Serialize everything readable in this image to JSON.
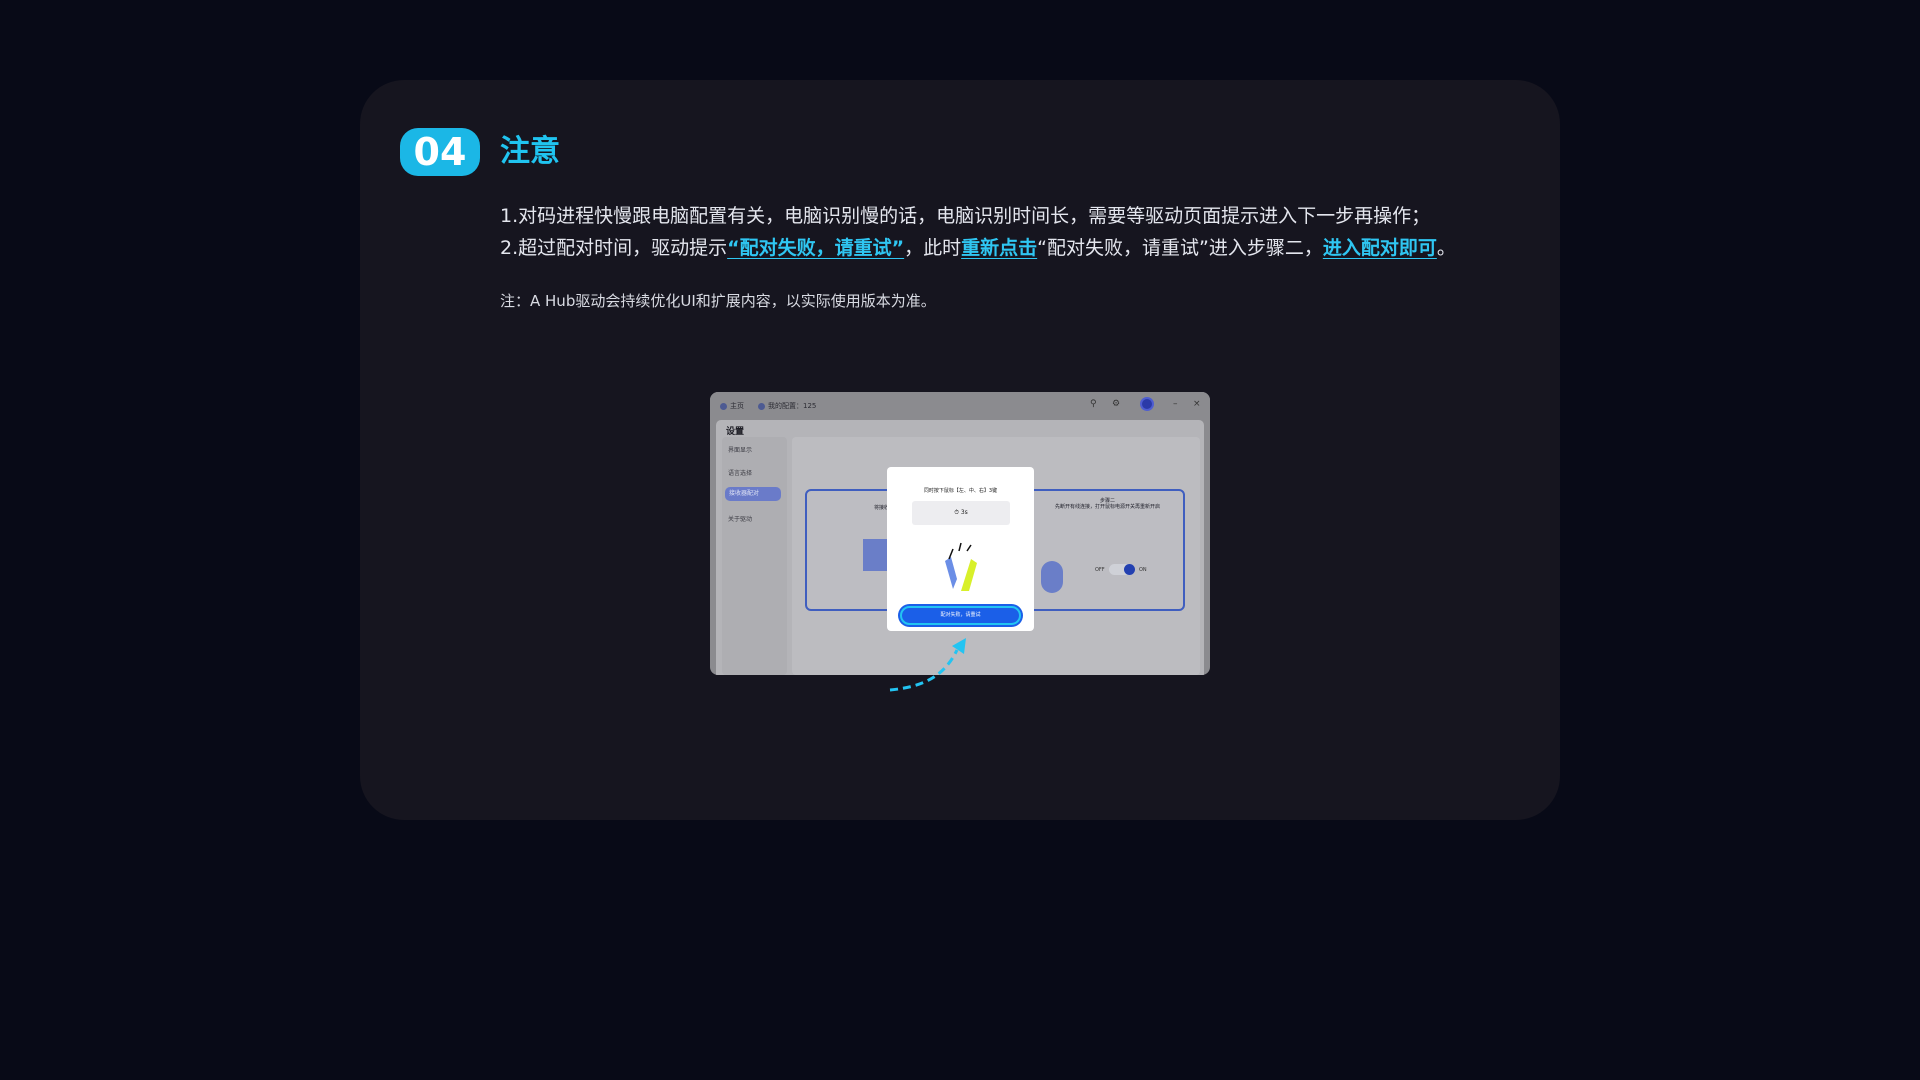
{
  "step": {
    "number": "04",
    "title": "注意"
  },
  "lines": {
    "l1": "1.对码进程快慢跟电脑配置有关，电脑识别慢的话，电脑识别时间长，需要等驱动页面提示进入下一步再操作；",
    "l2_a": "2.超过配对时间，驱动提示",
    "l2_link1": "“配对失败，请重试”",
    "l2_b": "，此时",
    "l2_link2": "重新点击",
    "l2_c": "“配对失败，请重试”进入步骤二，",
    "l2_link3": "进入配对即可",
    "l2_d": "。"
  },
  "note": "注：A Hub驱动会持续优化UI和扩展内容，以实际使用版本为准。",
  "screenshot": {
    "titlebar": {
      "home": "主页",
      "config": "我的配置：125"
    },
    "window_title": "设置",
    "sidebar": [
      "界面显示",
      "语言选择",
      "接收器配对",
      "关于驱动"
    ],
    "step2_title": "步骤二",
    "step2_desc": "先断开有线连接，打开鼠标电源开关再重新开启",
    "step1_title": "将接收",
    "modal_prompt": "同时按下鼠标【左、中、右】3键",
    "countdown": "3s",
    "retry_button": "配对失败，请重试",
    "toggle_off": "OFF",
    "toggle_on": "ON"
  },
  "colors": {
    "accent": "#1bb7e6",
    "link": "#2fc6f2",
    "primary_button": "#1b5fe8"
  }
}
